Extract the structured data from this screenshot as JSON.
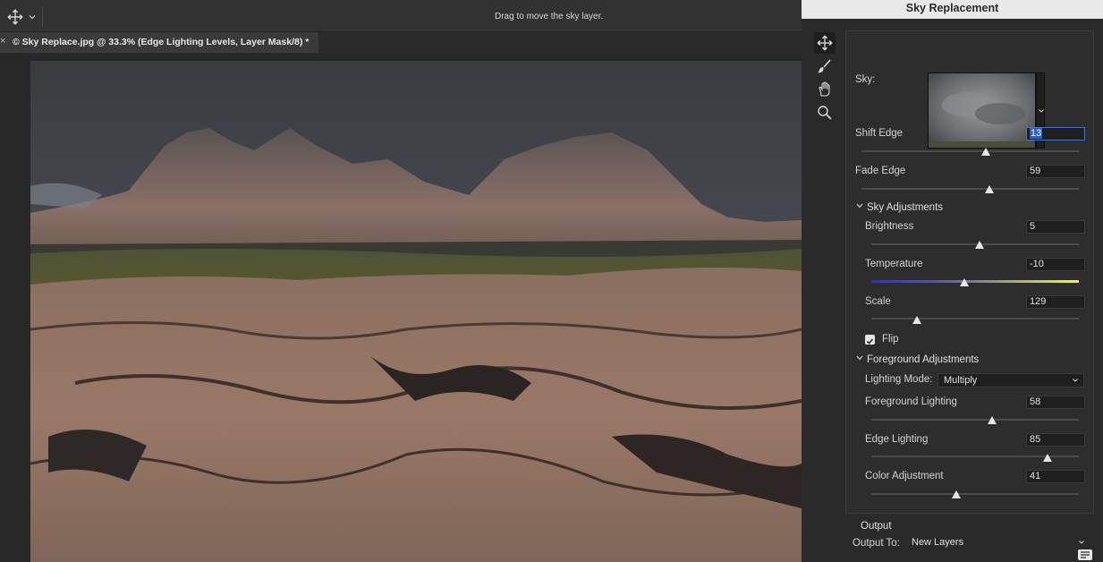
{
  "options_bar": {
    "hint": "Drag to move the sky layer."
  },
  "document_tab": {
    "close": "×",
    "title": "© Sky Replace.jpg @ 33.3% (Edge Lighting Levels, Layer Mask/8) *"
  },
  "panel": {
    "title": "Sky Replacement",
    "tools": [
      "move-sky-icon",
      "sky-brush-icon",
      "hand-icon",
      "zoom-icon"
    ],
    "sky_label": "Sky:",
    "shift_edge": {
      "label": "Shift Edge",
      "value": "13",
      "level": 0.57
    },
    "fade_edge": {
      "label": "Fade Edge",
      "value": "59",
      "level": 0.59
    },
    "sky_adjustments": {
      "title": "Sky Adjustments",
      "brightness": {
        "label": "Brightness",
        "value": "5",
        "level": 0.52
      },
      "temperature": {
        "label": "Temperature",
        "value": "-10",
        "level": 0.45
      },
      "scale": {
        "label": "Scale",
        "value": "129",
        "level": 0.22
      },
      "flip": {
        "label": "Flip",
        "checked": true
      }
    },
    "foreground_adjustments": {
      "title": "Foreground Adjustments",
      "lighting_mode_label": "Lighting Mode:",
      "lighting_mode_value": "Multiply",
      "foreground_lighting": {
        "label": "Foreground Lighting",
        "value": "58",
        "level": 0.58
      },
      "edge_lighting": {
        "label": "Edge Lighting",
        "value": "85",
        "level": 0.85
      },
      "color_adjustment": {
        "label": "Color Adjustment",
        "value": "41",
        "level": 0.41
      }
    },
    "output": {
      "title": "Output",
      "output_to_label": "Output To:",
      "output_to_value": "New Layers"
    }
  },
  "colors": {
    "panel_bg": "#2a2a2a",
    "selection": "#2f5fbf",
    "title_bar": "#e9e9e9"
  }
}
